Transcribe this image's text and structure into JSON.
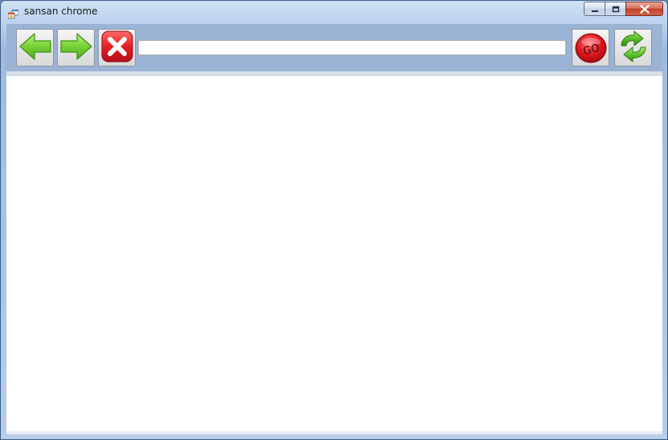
{
  "window": {
    "title": "sansan chrome",
    "icon": "app-window-icon"
  },
  "caption_buttons": {
    "minimize_icon": "minimize-icon",
    "maximize_icon": "maximize-icon",
    "close_icon": "close-icon"
  },
  "toolbar": {
    "back_icon": "green-left-arrow-icon",
    "forward_icon": "green-right-arrow-icon",
    "stop_icon": "red-x-icon",
    "go_label": "GO",
    "refresh_icon": "green-refresh-icon"
  },
  "address_bar": {
    "value": "",
    "placeholder": ""
  },
  "colors": {
    "toolbar_bg": "#9bb3d4",
    "arrow_green": "#6cc93a",
    "stop_red": "#e0202a",
    "go_red": "#d41616"
  }
}
